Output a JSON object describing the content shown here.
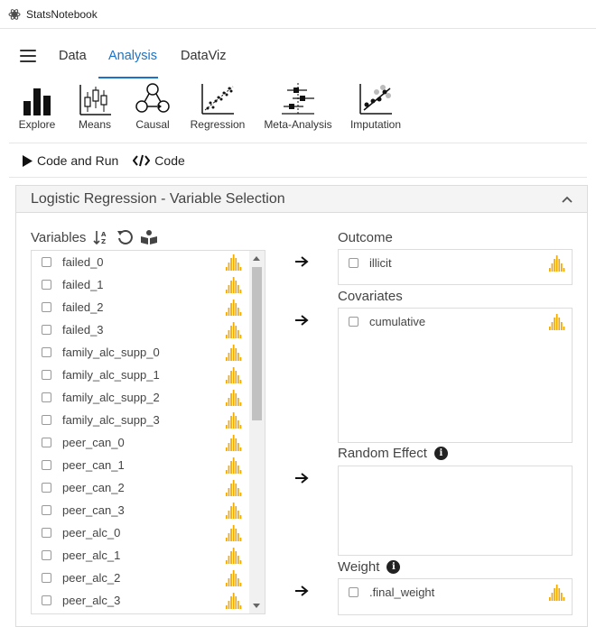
{
  "app": {
    "title": "StatsNotebook"
  },
  "nav": {
    "tabs": [
      {
        "label": "Data"
      },
      {
        "label": "Analysis",
        "active": true
      },
      {
        "label": "DataViz"
      }
    ]
  },
  "toolbar": {
    "items": [
      {
        "label": "Explore",
        "icon": "bar-chart-icon"
      },
      {
        "label": "Means",
        "icon": "boxplot-icon"
      },
      {
        "label": "Causal",
        "icon": "causal-graph-icon"
      },
      {
        "label": "Regression",
        "icon": "scatter-regression-icon"
      },
      {
        "label": "Meta-Analysis",
        "icon": "forest-plot-icon"
      },
      {
        "label": "Imputation",
        "icon": "imputation-scatter-icon"
      }
    ]
  },
  "actions": {
    "code_and_run": "Code and Run",
    "code": "Code"
  },
  "panel": {
    "title": "Logistic Regression - Variable Selection"
  },
  "variables": {
    "label": "Variables",
    "items": [
      "failed_0",
      "failed_1",
      "failed_2",
      "failed_3",
      "family_alc_supp_0",
      "family_alc_supp_1",
      "family_alc_supp_2",
      "family_alc_supp_3",
      "peer_can_0",
      "peer_can_1",
      "peer_can_2",
      "peer_can_3",
      "peer_alc_0",
      "peer_alc_1",
      "peer_alc_2",
      "peer_alc_3"
    ]
  },
  "outcome": {
    "label": "Outcome",
    "items": [
      "illicit"
    ]
  },
  "covariates": {
    "label": "Covariates",
    "items": [
      "cumulative"
    ]
  },
  "random_effect": {
    "label": "Random Effect",
    "items": []
  },
  "weight": {
    "label": "Weight",
    "items": [
      ".final_weight"
    ]
  },
  "colors": {
    "accent": "#1a73c9",
    "distribution": "#f2a900"
  }
}
